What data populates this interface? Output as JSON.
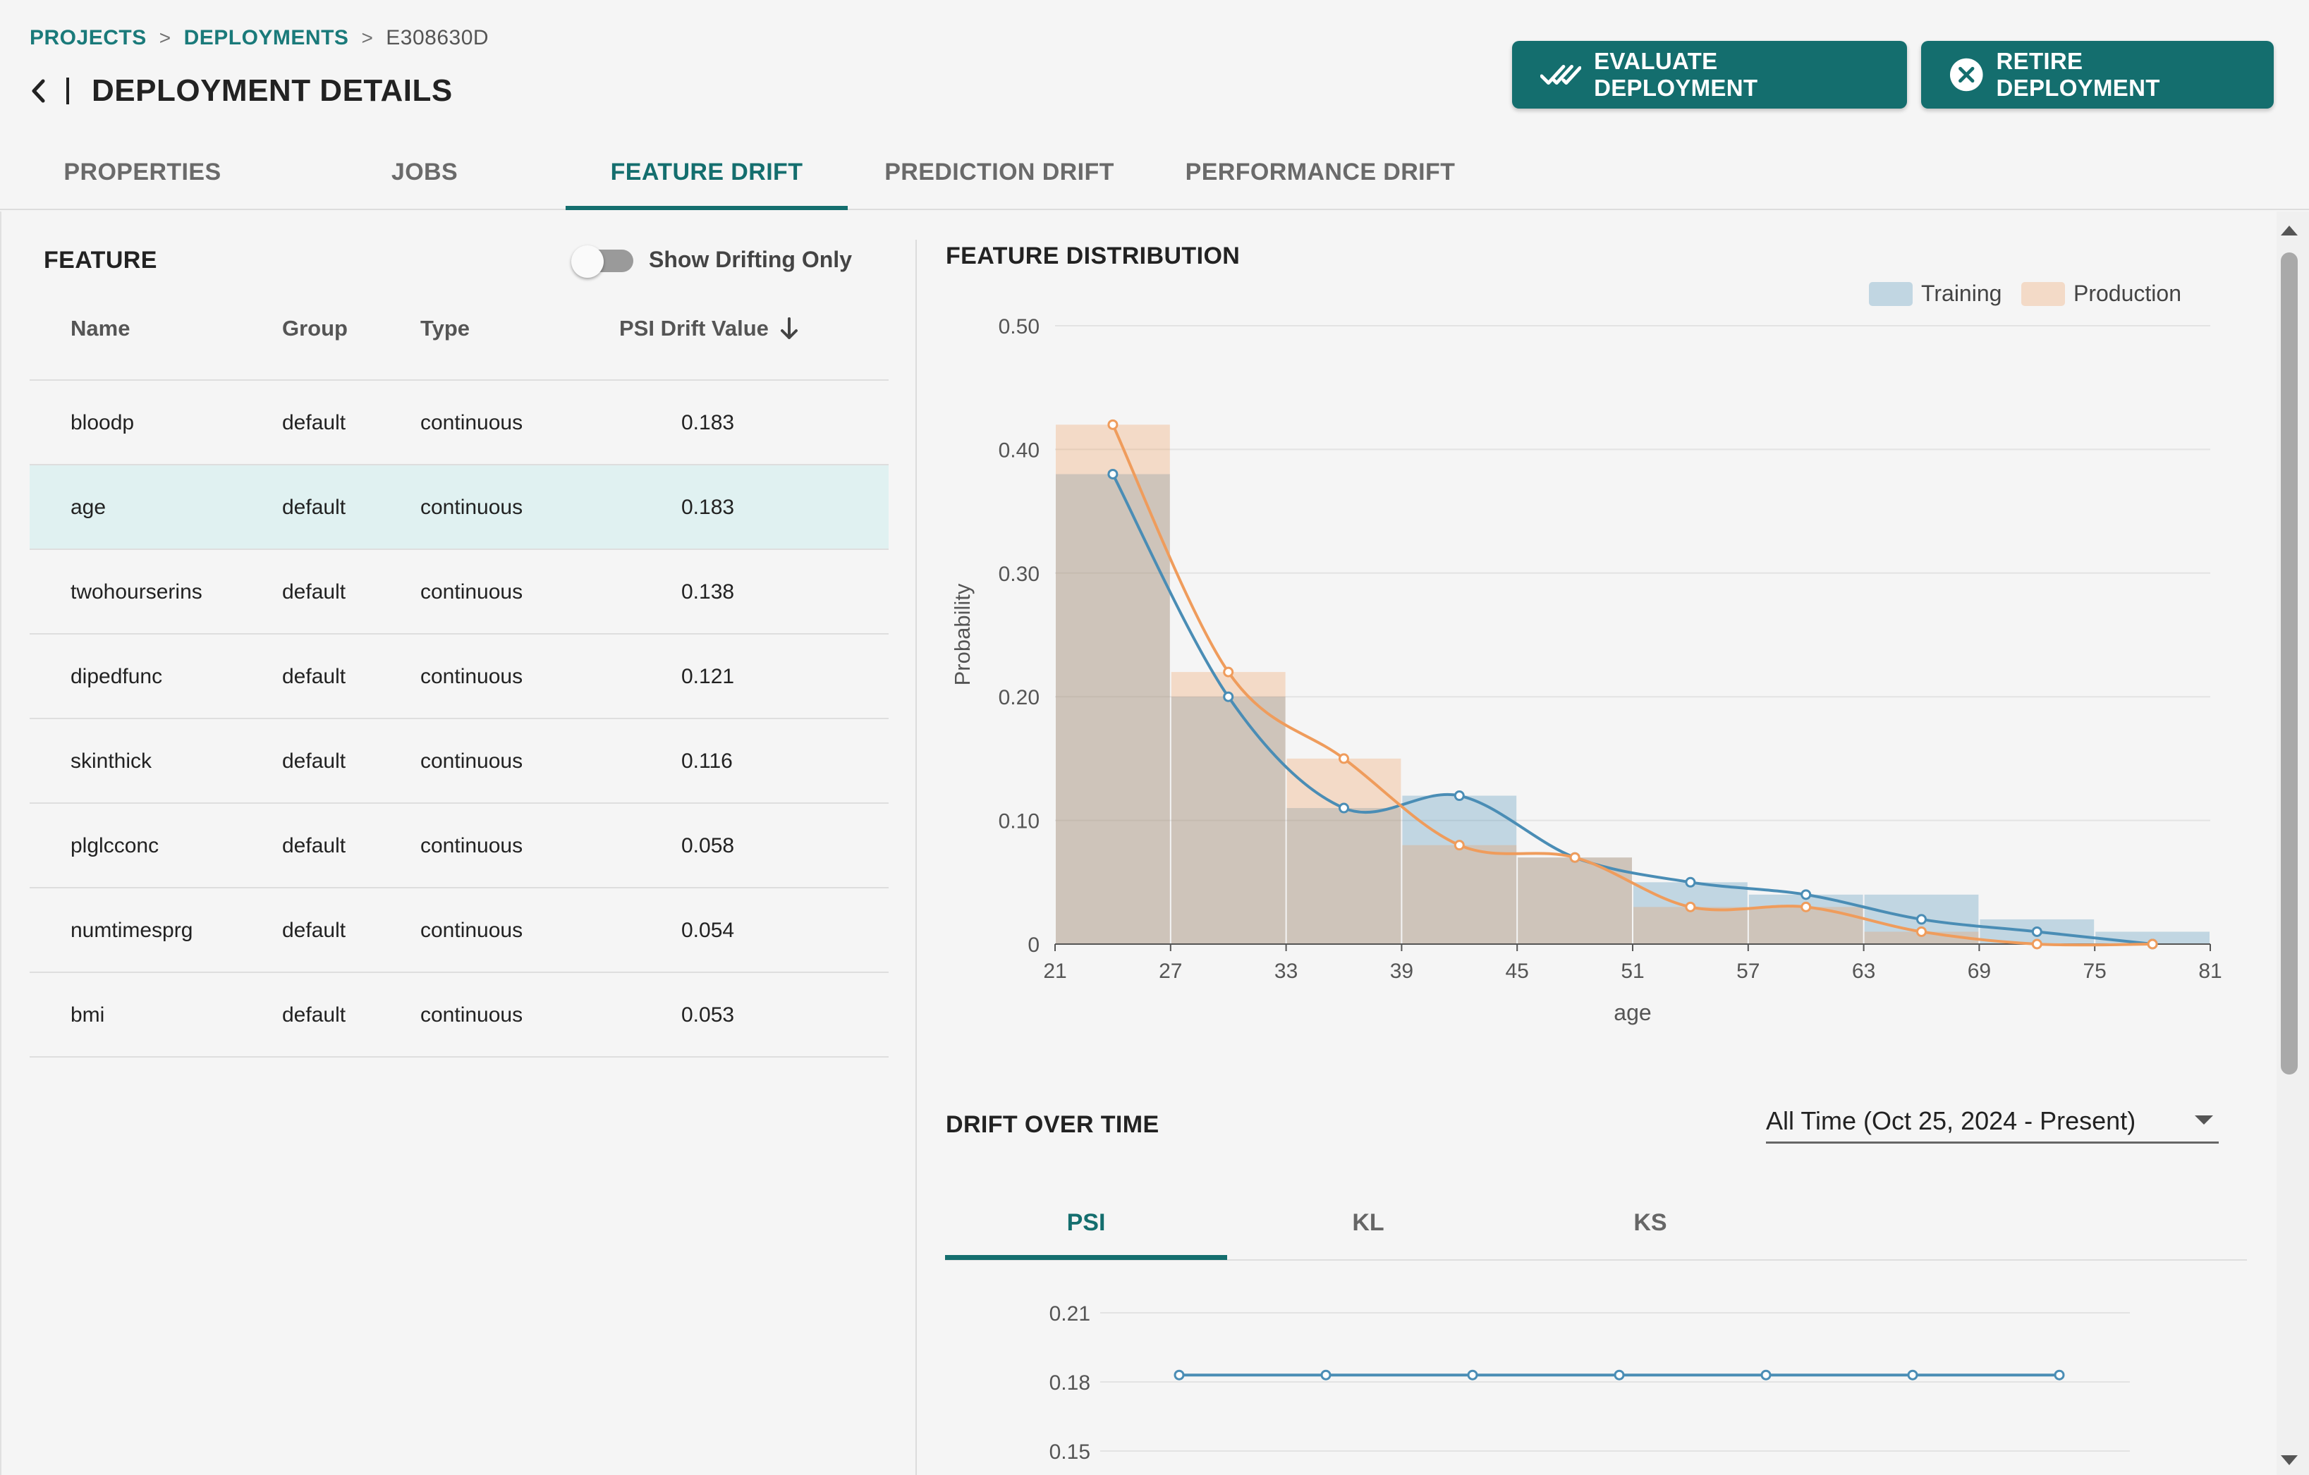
{
  "breadcrumb": {
    "projects": "PROJECTS",
    "deployments": "DEPLOYMENTS",
    "current": "E308630D",
    "separator": ">"
  },
  "page": {
    "title": "DEPLOYMENT DETAILS"
  },
  "actions": {
    "evaluate": "EVALUATE DEPLOYMENT",
    "retire": "RETIRE DEPLOYMENT"
  },
  "colors": {
    "accent": "#146e6e",
    "training": "#4a8db5",
    "production": "#ef9c5c",
    "selected_row": "#e0f1f1"
  },
  "tabs": [
    {
      "label": "PROPERTIES"
    },
    {
      "label": "JOBS"
    },
    {
      "label": "FEATURE DRIFT",
      "active": true
    },
    {
      "label": "PREDICTION DRIFT"
    },
    {
      "label": "PERFORMANCE DRIFT"
    }
  ],
  "feature_panel": {
    "title": "FEATURE",
    "toggle_label": "Show Drifting Only",
    "toggle_on": false,
    "columns": {
      "name": "Name",
      "group": "Group",
      "type": "Type",
      "psi": "PSI Drift Value"
    },
    "rows": [
      {
        "name": "bloodp",
        "group": "default",
        "type": "continuous",
        "psi": "0.183"
      },
      {
        "name": "age",
        "group": "default",
        "type": "continuous",
        "psi": "0.183",
        "selected": true
      },
      {
        "name": "twohourserins",
        "group": "default",
        "type": "continuous",
        "psi": "0.138"
      },
      {
        "name": "dipedfunc",
        "group": "default",
        "type": "continuous",
        "psi": "0.121"
      },
      {
        "name": "skinthick",
        "group": "default",
        "type": "continuous",
        "psi": "0.116"
      },
      {
        "name": "plglcconc",
        "group": "default",
        "type": "continuous",
        "psi": "0.058"
      },
      {
        "name": "numtimesprg",
        "group": "default",
        "type": "continuous",
        "psi": "0.054"
      },
      {
        "name": "bmi",
        "group": "default",
        "type": "continuous",
        "psi": "0.053"
      }
    ]
  },
  "distribution": {
    "title": "FEATURE DISTRIBUTION"
  },
  "drift_over_time": {
    "title": "DRIFT OVER TIME",
    "range_value": "All Time (Oct 25, 2024 - Present)",
    "metric_tabs": [
      {
        "label": "PSI",
        "active": true
      },
      {
        "label": "KL"
      },
      {
        "label": "KS"
      }
    ]
  },
  "chart_data": [
    {
      "type": "bar",
      "title": "",
      "xlabel": "age",
      "ylabel": "Probability",
      "xlim": [
        21,
        81
      ],
      "ylim": [
        0,
        0.5
      ],
      "xticks": [
        21,
        27,
        33,
        39,
        45,
        51,
        57,
        63,
        69,
        75,
        81
      ],
      "yticks": [
        0,
        0.1,
        0.2,
        0.3,
        0.4,
        0.5
      ],
      "ytick_labels": [
        "0",
        "0.10",
        "0.20",
        "0.30",
        "0.40",
        "0.50"
      ],
      "bin_edges": [
        21,
        27,
        33,
        39,
        45,
        51,
        57,
        63,
        69,
        75,
        81
      ],
      "legend": {
        "position": "top-right"
      },
      "grid": true,
      "series": [
        {
          "name": "Training",
          "bars": [
            0.38,
            0.2,
            0.11,
            0.12,
            0.07,
            0.05,
            0.04,
            0.04,
            0.02,
            0.01
          ],
          "curve_x": [
            24,
            30,
            36,
            42,
            48,
            54,
            60,
            66,
            72,
            78
          ],
          "curve_y": [
            0.38,
            0.2,
            0.11,
            0.12,
            0.07,
            0.05,
            0.04,
            0.02,
            0.01,
            0.0
          ]
        },
        {
          "name": "Production",
          "bars": [
            0.42,
            0.22,
            0.15,
            0.08,
            0.07,
            0.03,
            0.03,
            0.01,
            0.0,
            0.0
          ],
          "curve_x": [
            24,
            30,
            36,
            42,
            48,
            54,
            60,
            66,
            72,
            78
          ],
          "curve_y": [
            0.42,
            0.22,
            0.15,
            0.08,
            0.07,
            0.03,
            0.03,
            0.01,
            0.0,
            0.0
          ]
        }
      ]
    },
    {
      "type": "line",
      "title": "",
      "ylim": [
        0.15,
        0.21
      ],
      "yticks": [
        0.15,
        0.18,
        0.21
      ],
      "ytick_labels": [
        "0.15",
        "0.18",
        "0.21"
      ],
      "grid": true,
      "series": [
        {
          "values": [
            0.183,
            0.183,
            0.183,
            0.183,
            0.183,
            0.183,
            0.183
          ]
        }
      ]
    }
  ]
}
